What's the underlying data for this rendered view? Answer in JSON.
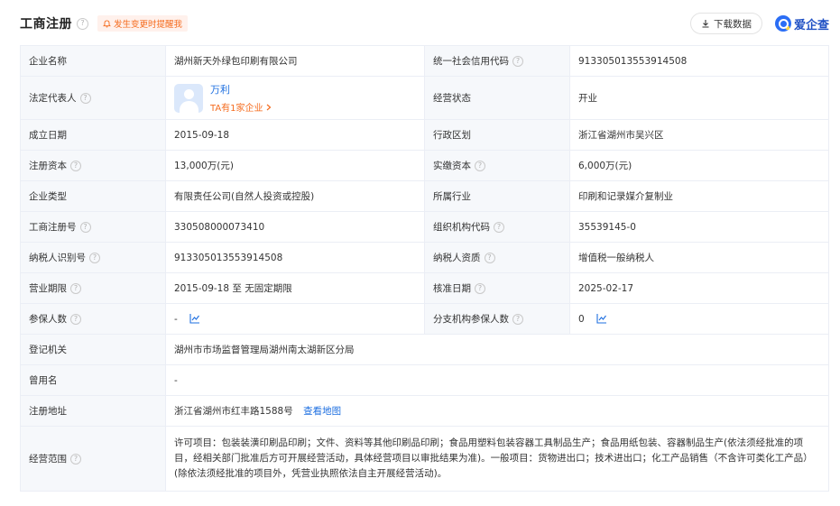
{
  "header": {
    "title": "工商注册",
    "notify_label": "发生变更时提醒我",
    "download_label": "下载数据",
    "brand_name": "爱企查"
  },
  "colors": {
    "accent_orange": "#f56c1f",
    "link_blue": "#1e6fe0",
    "label_bg": "#f6f8fb",
    "border": "#ebeef5"
  },
  "fields": {
    "company_name": {
      "label": "企业名称",
      "value": "湖州新天外绿包印刷有限公司"
    },
    "credit_code": {
      "label": "统一社会信用代码",
      "value": "913305013553914508"
    },
    "legal_rep": {
      "label": "法定代表人",
      "name": "万利",
      "companies": "TA有1家企业"
    },
    "status": {
      "label": "经营状态",
      "value": "开业"
    },
    "founded": {
      "label": "成立日期",
      "value": "2015-09-18"
    },
    "region": {
      "label": "行政区划",
      "value": "浙江省湖州市吴兴区"
    },
    "reg_capital": {
      "label": "注册资本",
      "value": "13,000万(元)"
    },
    "paid_capital": {
      "label": "实缴资本",
      "value": "6,000万(元)"
    },
    "company_type": {
      "label": "企业类型",
      "value": "有限责任公司(自然人投资或控股)"
    },
    "industry": {
      "label": "所属行业",
      "value": "印刷和记录媒介复制业"
    },
    "reg_number": {
      "label": "工商注册号",
      "value": "330508000073410"
    },
    "org_code": {
      "label": "组织机构代码",
      "value": "35539145-0"
    },
    "taxpayer_id": {
      "label": "纳税人识别号",
      "value": "913305013553914508"
    },
    "taxpayer_qual": {
      "label": "纳税人资质",
      "value": "增值税一般纳税人"
    },
    "term": {
      "label": "营业期限",
      "value": "2015-09-18 至 无固定期限"
    },
    "approval_date": {
      "label": "核准日期",
      "value": "2025-02-17"
    },
    "insured": {
      "label": "参保人数",
      "value": "-"
    },
    "branch_insured": {
      "label": "分支机构参保人数",
      "value": "0"
    },
    "authority": {
      "label": "登记机关",
      "value": "湖州市市场监督管理局湖州南太湖新区分局"
    },
    "former_name": {
      "label": "曾用名",
      "value": "-"
    },
    "address": {
      "label": "注册地址",
      "value": "浙江省湖州市红丰路1588号",
      "map_link": "查看地图"
    },
    "scope": {
      "label": "经营范围",
      "value": "许可项目：包装装潢印刷品印刷；文件、资料等其他印刷品印刷；食品用塑料包装容器工具制品生产；食品用纸包装、容器制品生产(依法须经批准的项目，经相关部门批准后方可开展经营活动，具体经营项目以审批结果为准)。一般项目：货物进出口；技术进出口；化工产品销售（不含许可类化工产品）(除依法须经批准的项目外，凭营业执照依法自主开展经营活动)。"
    }
  }
}
